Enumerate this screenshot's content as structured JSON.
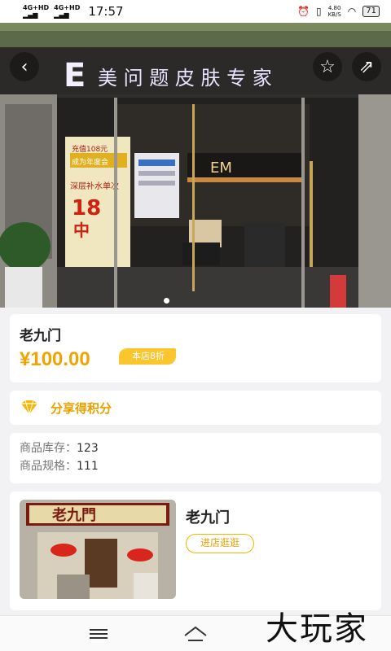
{
  "status_bar": {
    "network_1": "4G+HD",
    "network_2": "4G+HD",
    "time": "17:57",
    "speed_value": "4.80",
    "speed_unit": "KB/S",
    "battery": "71"
  },
  "hero": {
    "sign_letter": "E",
    "sign_text": "美 问 题 皮 肤 专 家",
    "inner_sign_text": "EM",
    "poster_lines": [
      "充值108元",
      "成为年度会",
      "深层补水单次",
      "18",
      "中"
    ]
  },
  "product": {
    "title": "老九门",
    "price": "¥100.00",
    "discount_badge": "本店8折"
  },
  "share": {
    "label": "分享得积分"
  },
  "info": {
    "stock_label": "商品库存：",
    "stock_value": "123",
    "spec_label": "商品规格：",
    "spec_value": "111"
  },
  "shop": {
    "name": "老九门",
    "sign_text": "老九門",
    "visit_button": "进店逛逛"
  },
  "watermark": "大玩家",
  "icons": {
    "back": "chevron-left-icon",
    "favorite": "star-icon",
    "share": "share-icon",
    "gem": "diamond-icon",
    "menu": "menu-icon",
    "home": "home-icon"
  },
  "colors": {
    "accent": "#f2a300",
    "badge": "#fbc52d",
    "background": "#f2f2f4"
  }
}
